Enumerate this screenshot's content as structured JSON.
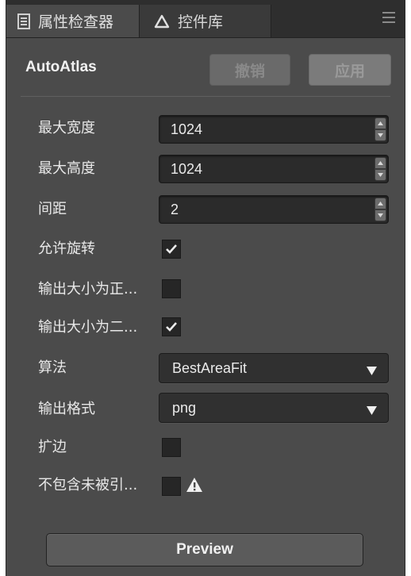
{
  "tabs": [
    {
      "label": "属性检查器",
      "icon": "inspector-icon",
      "active": true
    },
    {
      "label": "控件库",
      "icon": "triangle-icon",
      "active": false
    }
  ],
  "header": {
    "title": "AutoAtlas",
    "undo_label": "撤销",
    "apply_label": "应用"
  },
  "fields": {
    "max_width": {
      "label": "最大宽度",
      "value": "1024"
    },
    "max_height": {
      "label": "最大高度",
      "value": "1024"
    },
    "padding": {
      "label": "间距",
      "value": "2"
    },
    "allow_rotation": {
      "label": "允许旋转",
      "checked": true
    },
    "force_square": {
      "label": "输出大小为正...",
      "checked": false
    },
    "power_of_two": {
      "label": "输出大小为二...",
      "checked": true
    },
    "algorithm": {
      "label": "算法",
      "value": "BestAreaFit"
    },
    "format": {
      "label": "输出格式",
      "value": "png"
    },
    "extrude": {
      "label": "扩边",
      "checked": false
    },
    "filter_unused": {
      "label": "不包含未被引...",
      "checked": false
    }
  },
  "preview_label": "Preview",
  "colors": {
    "panel_bg": "#4b4b4b",
    "tabbar_bg": "#2e2e2e",
    "input_bg": "#2b2b2b",
    "text": "#e8e8e8"
  }
}
